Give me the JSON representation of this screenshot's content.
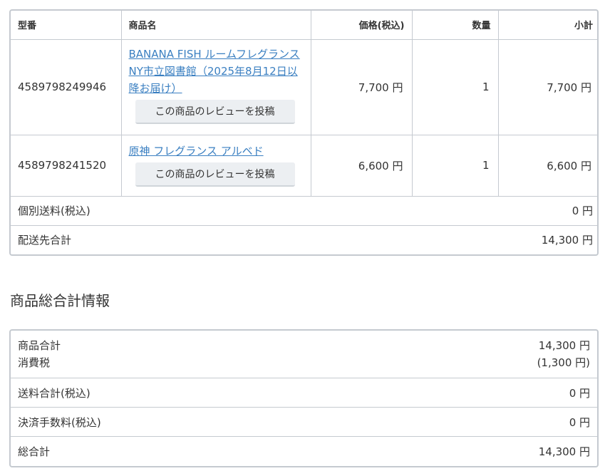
{
  "order_table": {
    "headers": {
      "model": "型番",
      "name": "商品名",
      "price": "価格(税込)",
      "qty": "数量",
      "subtotal": "小計"
    },
    "items": [
      {
        "code": "4589798249946",
        "name": "BANANA FISH ルームフレグランス NY市立図書館（2025年8月12日以降お届け）",
        "review_label": "この商品のレビューを投稿",
        "price": "7,700 円",
        "qty": "1",
        "subtotal": "7,700 円"
      },
      {
        "code": "4589798241520",
        "name": "原神 フレグランス アルベド",
        "review_label": "この商品のレビューを投稿",
        "price": "6,600 円",
        "qty": "1",
        "subtotal": "6,600 円"
      }
    ],
    "shipping": {
      "label": "個別送料(税込)",
      "value": "0 円"
    },
    "dest_total": {
      "label": "配送先合計",
      "value": "14,300 円"
    }
  },
  "summary": {
    "heading": "商品総合計情報",
    "product_total": {
      "label": "商品合計",
      "value": "14,300 円"
    },
    "tax": {
      "label": "消費税",
      "value": "(1,300 円)"
    },
    "shipping_total": {
      "label": "送料合計(税込)",
      "value": "0 円"
    },
    "fee": {
      "label": "決済手数料(税込)",
      "value": "0 円"
    },
    "grand_total": {
      "label": "総合計",
      "value": "14,300 円"
    }
  }
}
